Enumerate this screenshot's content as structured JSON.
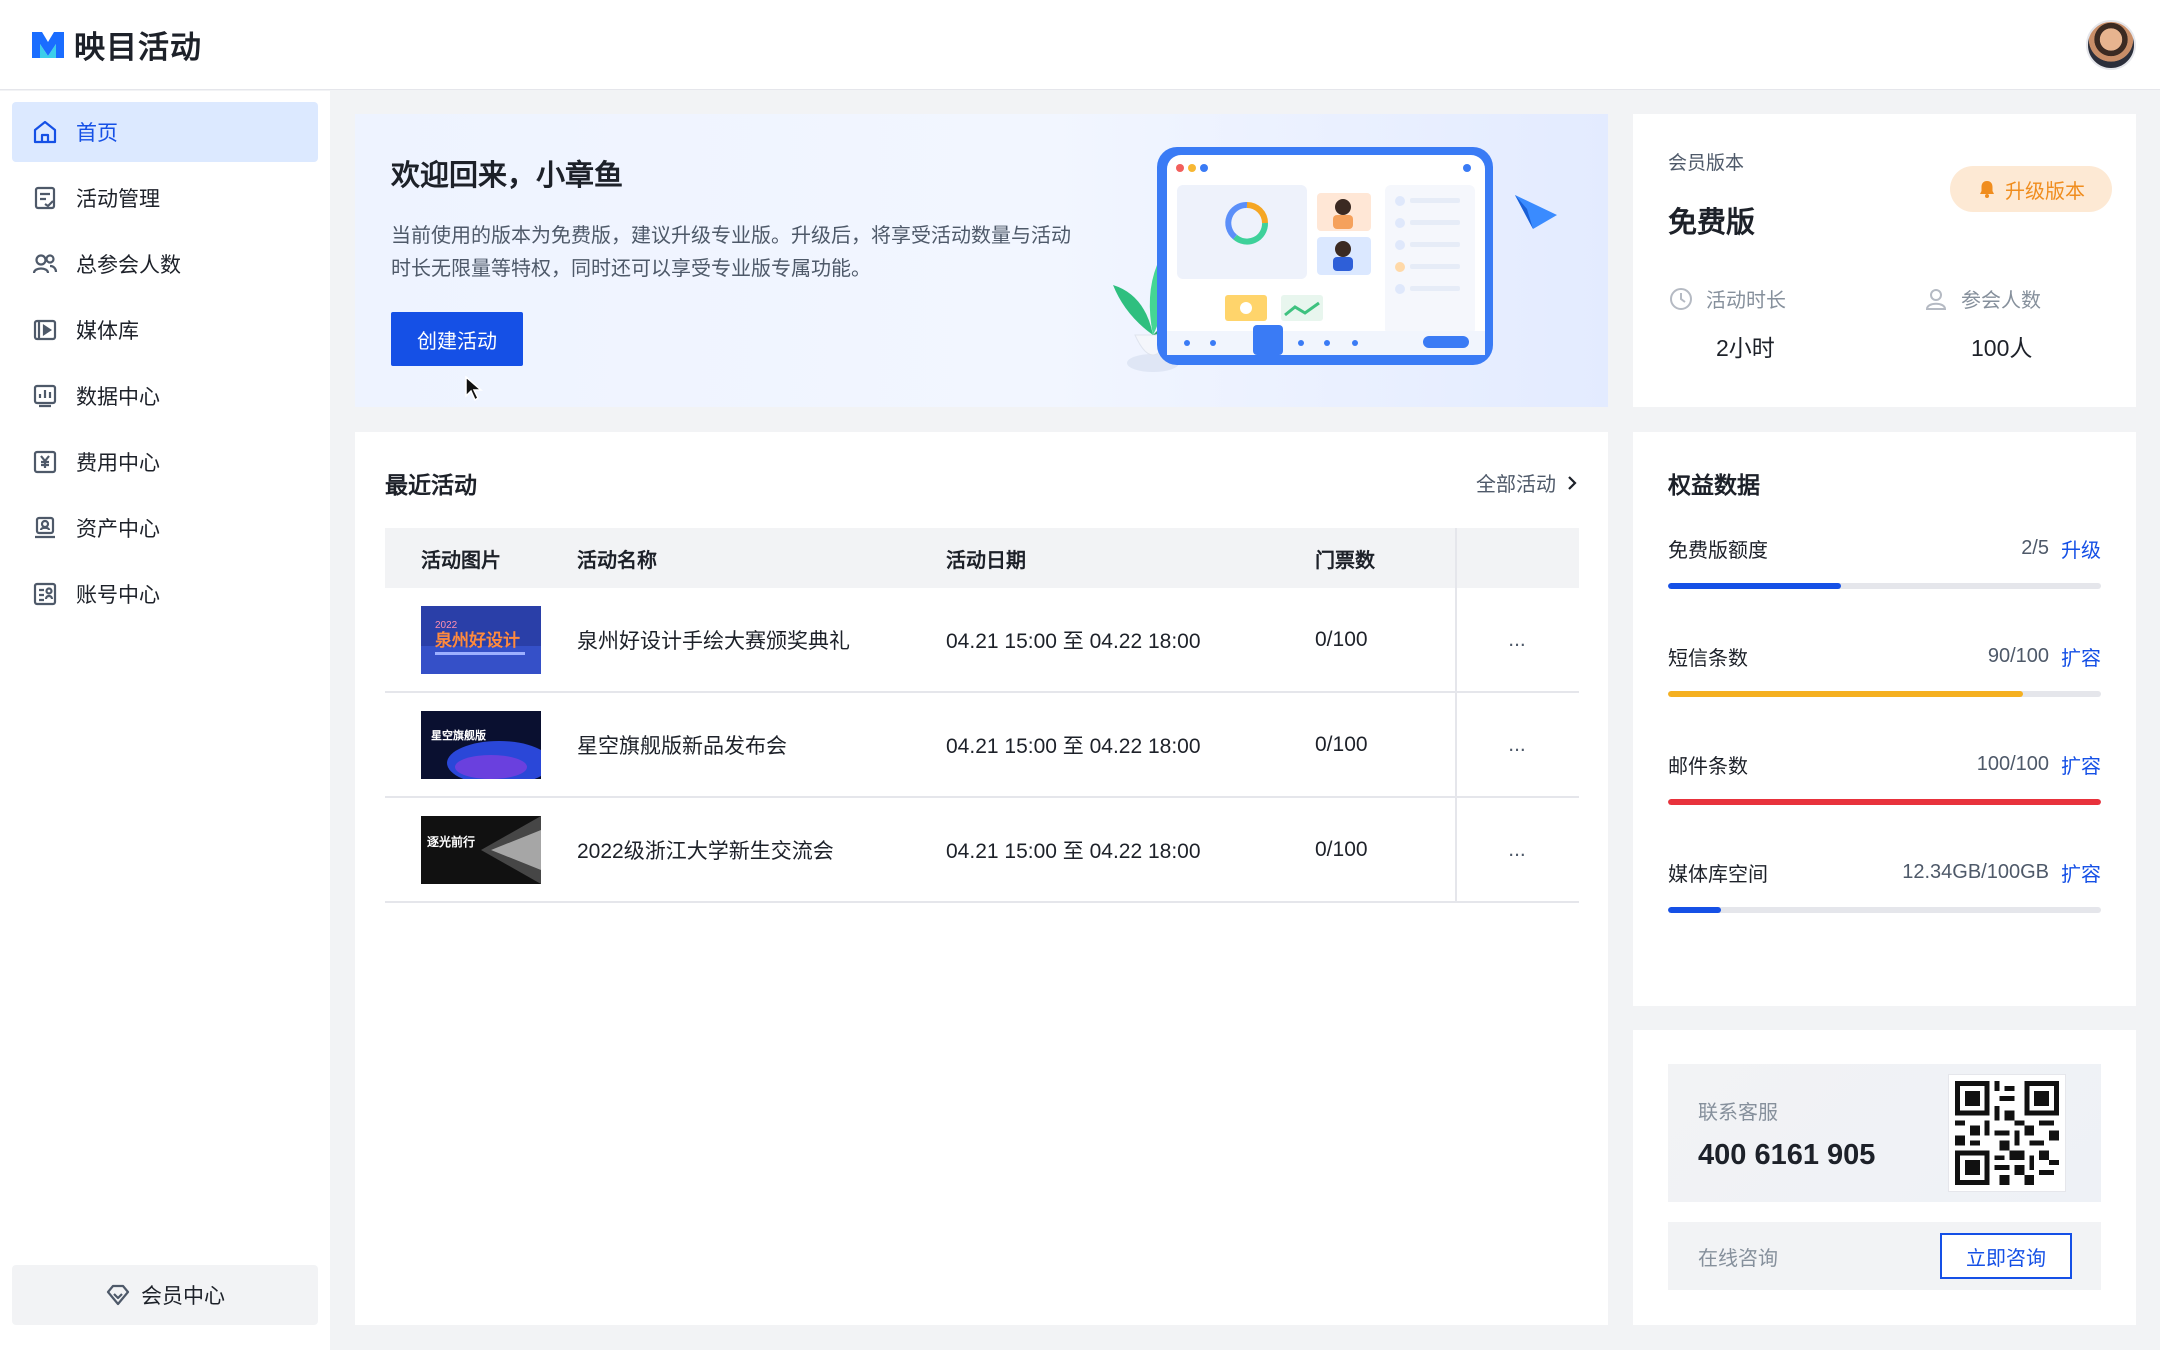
{
  "app": {
    "name": "映目活动"
  },
  "sidebar": {
    "items": [
      {
        "label": "首页",
        "icon": "home-icon",
        "active": true
      },
      {
        "label": "活动管理",
        "icon": "activity-manage-icon"
      },
      {
        "label": "总参会人数",
        "icon": "users-icon"
      },
      {
        "label": "媒体库",
        "icon": "media-library-icon"
      },
      {
        "label": "数据中心",
        "icon": "data-chart-icon"
      },
      {
        "label": "费用中心",
        "icon": "yen-icon"
      },
      {
        "label": "资产中心",
        "icon": "asset-icon"
      },
      {
        "label": "账号中心",
        "icon": "account-icon"
      }
    ],
    "member_center": "会员中心"
  },
  "welcome": {
    "title": "欢迎回来，小章鱼",
    "description": "当前使用的版本为免费版，建议升级专业版。升级后，将享受活动数量与活动时长无限量等特权，同时还可以享受专业版专属功能。",
    "create_button": "创建活动"
  },
  "membership": {
    "label": "会员版本",
    "plan": "免费版",
    "upgrade_button": "升级版本",
    "duration_label": "活动时长",
    "duration_value": "2小时",
    "attendees_label": "参会人数",
    "attendees_value": "100人"
  },
  "recent": {
    "title": "最近活动",
    "all_link": "全部活动",
    "columns": [
      "活动图片",
      "活动名称",
      "活动日期",
      "门票数"
    ],
    "rows": [
      {
        "name": "泉州好设计手绘大赛颁奖典礼",
        "date": "04.21 15:00 至 04.22 18:00",
        "tickets": "0/100",
        "more": "...",
        "thumb_text": "泉州好设计",
        "thumb_year": "2022"
      },
      {
        "name": "星空旗舰版新品发布会",
        "date": "04.21 15:00 至 04.22 18:00",
        "tickets": "0/100",
        "more": "...",
        "thumb_text": "星空旗舰版"
      },
      {
        "name": "2022级浙江大学新生交流会",
        "date": "04.21 15:00 至 04.22 18:00",
        "tickets": "0/100",
        "more": "...",
        "thumb_text": "逐光前行"
      }
    ]
  },
  "benefits": {
    "title": "权益数据",
    "items": [
      {
        "label": "免费版额度",
        "value": "2/5",
        "action": "升级",
        "fraction": 0.4,
        "color": "#1550e6"
      },
      {
        "label": "短信条数",
        "value": "90/100",
        "action": "扩容",
        "fraction": 0.82,
        "color": "#f5b020"
      },
      {
        "label": "邮件条数",
        "value": "100/100",
        "action": "扩容",
        "fraction": 1.0,
        "color": "#e8323c"
      },
      {
        "label": "媒体库空间",
        "value": "12.34GB/100GB",
        "action": "扩容",
        "fraction": 0.1234,
        "color": "#1550e6"
      }
    ]
  },
  "contact": {
    "label": "联系客服",
    "phone": "400 6161 905",
    "online_label": "在线咨询",
    "consult_button": "立即咨询"
  },
  "colors": {
    "primary": "#1550e6",
    "warning": "#f5b020",
    "danger": "#e8323c",
    "upgrade": "#f08d1e"
  }
}
